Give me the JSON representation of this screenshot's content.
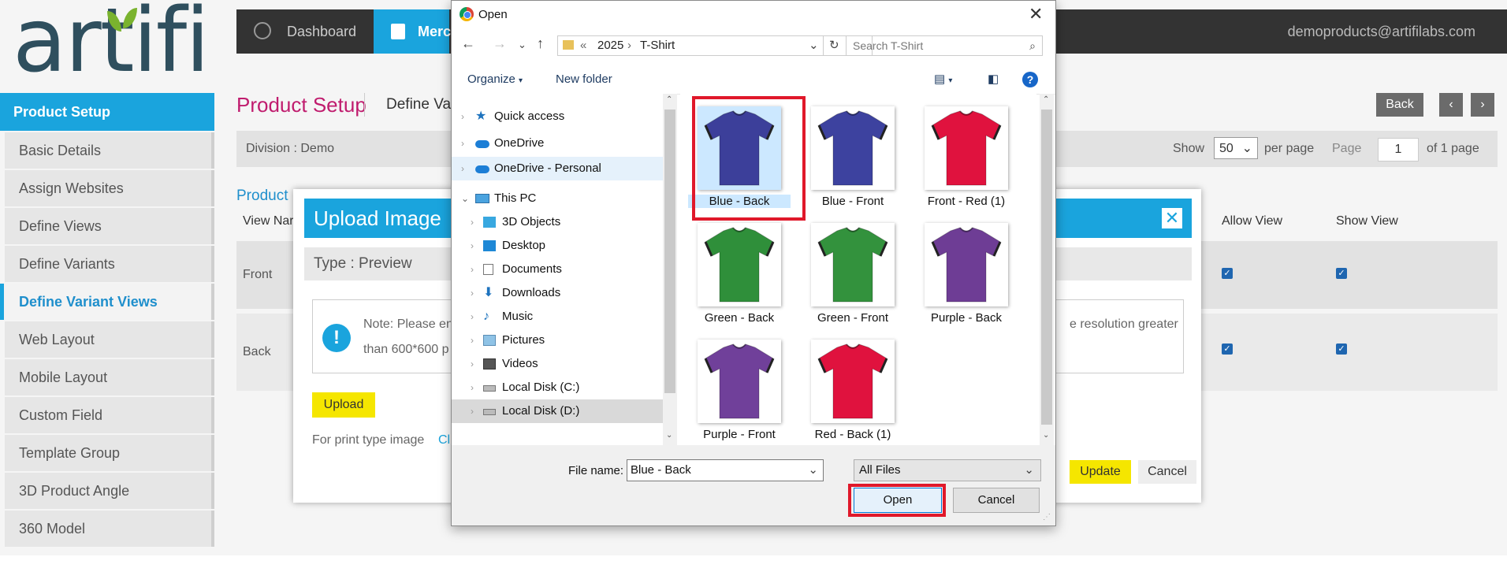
{
  "logo_text": "artifi",
  "nav": {
    "dashboard": "Dashboard",
    "merch": "Merc",
    "email": "demoproducts@artifilabs.com"
  },
  "sidebar": {
    "header": "Product Setup",
    "items": [
      "Basic Details",
      "Assign Websites",
      "Define Views",
      "Define Variants",
      "Define Variant Views",
      "Web Layout",
      "Mobile Layout",
      "Custom Field",
      "Template Group",
      "3D Product Angle",
      "360 Model"
    ],
    "active": "Define Variant Views"
  },
  "header": {
    "title": "Product Setup",
    "subtitle": "Define Vari",
    "back": "Back"
  },
  "division": {
    "label": "Division : ",
    "value": "Demo",
    "show": "Show",
    "per_page_value": "50",
    "per_page": "per page",
    "page": "Page",
    "page_value": "1",
    "of_page": "of 1 page"
  },
  "table": {
    "heading": "Product I",
    "col_view_name": "View Nar",
    "col_allow_view": "Allow View",
    "col_show_view": "Show View",
    "rows": [
      {
        "label": "Front",
        "allow": true,
        "show": true
      },
      {
        "label": "Back",
        "allow": true,
        "show": true
      }
    ]
  },
  "modal": {
    "title": "Upload Image",
    "type": "Type : Preview",
    "note_line1": "Note: Please en",
    "note_line2": "than 600*600 p",
    "note_line1_end": "e resolution greater",
    "upload": "Upload",
    "print_label": "For print type image",
    "click_link": "Cli",
    "update": "Update",
    "cancel": "Cancel"
  },
  "dialog": {
    "title": "Open",
    "breadcrumb_sep": "«",
    "path1": "2025",
    "path2": "T-Shirt",
    "search_placeholder": "Search T-Shirt",
    "organize": "Organize",
    "new_folder": "New folder",
    "tree": [
      {
        "label": "Quick access",
        "icon": "star-icon",
        "indent": 0
      },
      {
        "label": "OneDrive",
        "icon": "cloud-icon",
        "indent": 0
      },
      {
        "label": "OneDrive - Personal",
        "icon": "cloud-icon",
        "indent": 0,
        "selected": true
      },
      {
        "label": "This PC",
        "icon": "computer-icon",
        "indent": 0
      },
      {
        "label": "3D Objects",
        "icon": "cube-icon",
        "indent": 1
      },
      {
        "label": "Desktop",
        "icon": "desktop-icon",
        "indent": 1
      },
      {
        "label": "Documents",
        "icon": "document-icon",
        "indent": 1
      },
      {
        "label": "Downloads",
        "icon": "download-icon",
        "indent": 1
      },
      {
        "label": "Music",
        "icon": "music-icon",
        "indent": 1
      },
      {
        "label": "Pictures",
        "icon": "picture-icon",
        "indent": 1
      },
      {
        "label": "Videos",
        "icon": "video-icon",
        "indent": 1
      },
      {
        "label": "Local Disk (C:)",
        "icon": "disk-icon",
        "indent": 1
      },
      {
        "label": "Local Disk (D:)",
        "icon": "disk-icon",
        "indent": 1,
        "hover": true
      }
    ],
    "files": [
      {
        "label": "Blue - Back",
        "color": "#3c3f9a",
        "selected": true
      },
      {
        "label": "Blue - Front",
        "color": "#3d429f"
      },
      {
        "label": "Front - Red (1)",
        "color": "#e0123e"
      },
      {
        "label": "Green - Back",
        "color": "#2f8f3a"
      },
      {
        "label": "Green - Front",
        "color": "#33923d"
      },
      {
        "label": "Purple - Back",
        "color": "#6e3d95"
      },
      {
        "label": "Purple - Front",
        "color": "#70409a"
      },
      {
        "label": "Red - Back (1)",
        "color": "#e0123e"
      }
    ],
    "file_name_label": "File name:",
    "file_name_value": "Blue - Back",
    "file_type": "All Files",
    "open": "Open",
    "cancel": "Cancel"
  }
}
